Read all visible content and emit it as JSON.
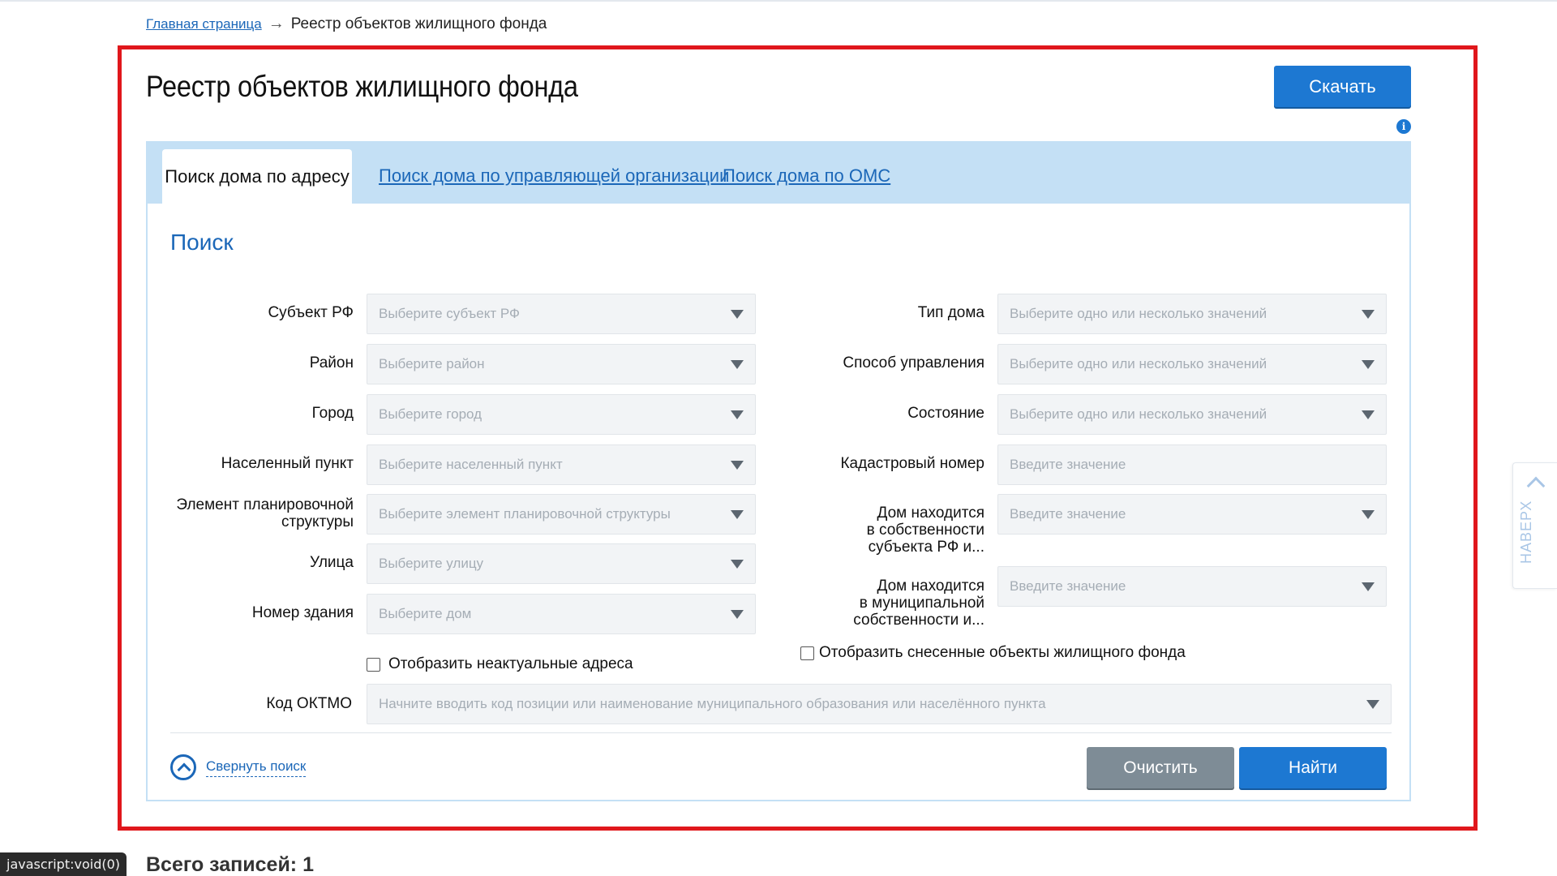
{
  "breadcrumb": {
    "home": "Главная страница",
    "arrow": "→",
    "current": "Реестр объектов жилищного фонда"
  },
  "page": {
    "title": "Реестр объектов жилищного фонда",
    "download_label": "Скачать",
    "info_icon": "i"
  },
  "tabs": [
    {
      "label": "Поиск дома по адресу",
      "active": true
    },
    {
      "label": "Поиск дома по управляющей организации",
      "active": false
    },
    {
      "label": "Поиск дома по ОМС",
      "active": false
    }
  ],
  "search": {
    "heading": "Поиск",
    "left": [
      {
        "label": "Субъект РФ",
        "placeholder": "Выберите субъект РФ"
      },
      {
        "label": "Район",
        "placeholder": "Выберите район"
      },
      {
        "label": "Город",
        "placeholder": "Выберите город"
      },
      {
        "label": "Населенный пункт",
        "placeholder": "Выберите населенный пункт"
      },
      {
        "label_line1": "Элемент планировочной",
        "label_line2": "структуры",
        "placeholder": "Выберите элемент планировочной структуры"
      },
      {
        "label": "Улица",
        "placeholder": "Выберите улицу"
      },
      {
        "label": "Номер здания",
        "placeholder": "Выберите дом"
      }
    ],
    "right": [
      {
        "label": "Тип дома",
        "placeholder": "Выберите одно или несколько значений"
      },
      {
        "label": "Способ управления",
        "placeholder": "Выберите одно или несколько значений"
      },
      {
        "label": "Состояние",
        "placeholder": "Выберите одно или несколько значений"
      },
      {
        "label": "Кадастровый номер",
        "placeholder": "Введите значение"
      },
      {
        "label_line1": "Дом находится",
        "label_line2": "в собственности",
        "label_line3": "субъекта РФ и...",
        "placeholder": "Введите значение"
      },
      {
        "label_line1": "Дом находится",
        "label_line2": "в муниципальной",
        "label_line3": "собственности и...",
        "placeholder": "Введите значение"
      }
    ],
    "show_inactive_label": "Отобразить неактуальные адреса",
    "show_demolished_label": "Отобразить снесенные объекты жилищного фонда",
    "oktmo": {
      "label": "Код ОКТМО",
      "placeholder": "Начните вводить код позиции или наименование муниципального образования или населённого пункта"
    },
    "collapse_label": "Свернуть поиск",
    "clear_label": "Очистить",
    "find_label": "Найти"
  },
  "to_top_label": "НАВЕРХ",
  "status_bar": "javascript:void(0)",
  "total_records": "Всего записей: 1"
}
